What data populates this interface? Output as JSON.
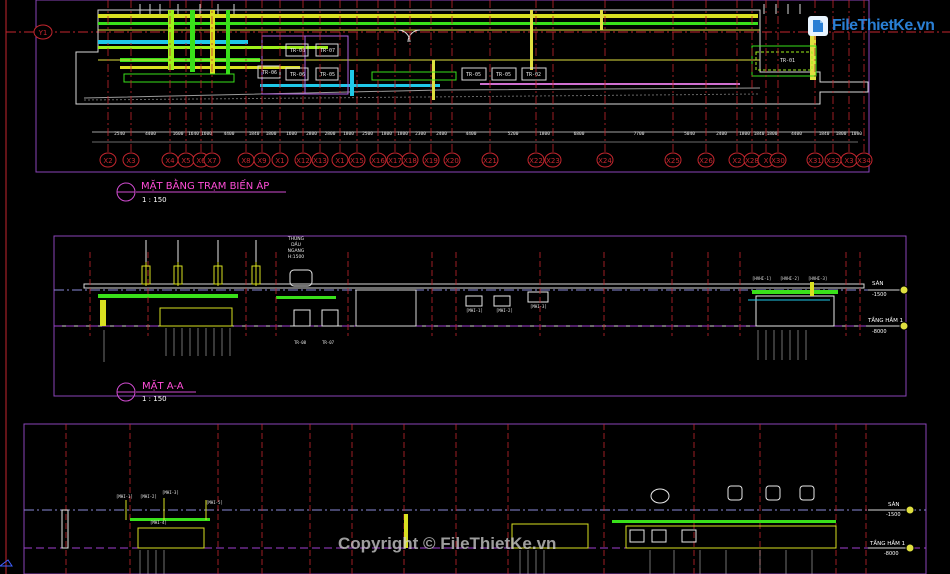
{
  "logo": {
    "text": "FileThietKe.vn"
  },
  "watermark": "Copyright © FileThietKe.vn",
  "plan": {
    "title": "MẶT BẰNG TRẠM BIẾN ÁP",
    "scale": "1 : 150",
    "grid_y": "Y1",
    "grid_x": [
      "X2",
      "X3",
      "X4",
      "X5",
      "X6",
      "X7",
      "X8",
      "X9",
      "X1",
      "X12",
      "X13",
      "X1",
      "X15",
      "X16",
      "X17",
      "X18",
      "X19",
      "X20",
      "X21",
      "X22",
      "X23",
      "X24",
      "X25",
      "X26",
      "X2",
      "X28",
      "X",
      "X30",
      "X31",
      "X32",
      "X3",
      "X34"
    ],
    "dims": [
      "2540",
      "4400",
      "1600",
      "1640",
      "1600",
      "4400",
      "1840",
      "1800",
      "1600",
      "2800",
      "2800",
      "1800",
      "2500",
      "1800",
      "1800",
      "2300",
      "2400",
      "4400",
      "5200",
      "1800",
      "6800",
      "7700",
      "5040",
      "2400",
      "1800",
      "1840",
      "1800",
      "4400",
      "1840",
      "1800",
      "1080"
    ],
    "tr_labels": [
      "TR-08",
      "TR-07",
      "TR-06",
      "TR-05",
      "TR-06",
      "TR-05",
      "TR-05",
      "TR-02",
      "TR-01"
    ]
  },
  "section1": {
    "title": "MẶT A-A",
    "scale": "1 : 150",
    "note": [
      "THÙNG",
      "DẦU",
      "NGANG",
      "H:1500"
    ],
    "levels": [
      {
        "name": "SÀN",
        "value": "-1500"
      },
      {
        "name": "TẦNG HẦM 1",
        "value": "-8000"
      }
    ],
    "tags": [
      "[MHI-1]",
      "[MHI-2]",
      "[MHI-3]",
      "[HVHI-1]",
      "[HVHI-2]",
      "[HVHI-3]",
      "TR-08",
      "TR-07"
    ]
  },
  "section2": {
    "levels": [
      {
        "name": "SÀN",
        "value": "-1500"
      },
      {
        "name": "TẦNG HẦM 1",
        "value": "-8000"
      }
    ],
    "tags": [
      "[MHI-1]",
      "[MHI-2]",
      "[MHI-3]",
      "[MHI-4]",
      "[MHI-5]"
    ]
  }
}
